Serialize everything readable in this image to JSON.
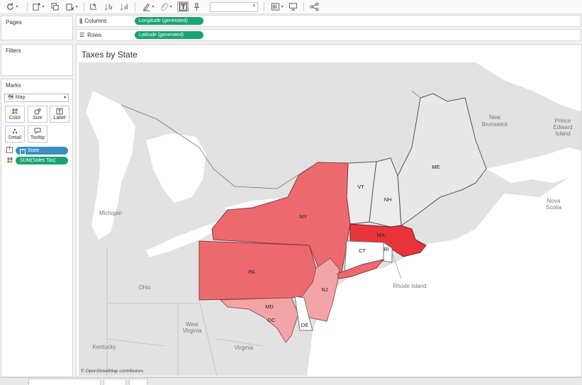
{
  "shelves": {
    "pages_title": "Pages",
    "filters_title": "Filters",
    "columns_label": "Columns",
    "columns_pill": "Longitude (generated)",
    "rows_label": "Rows",
    "rows_pill": "Latitude (generated)"
  },
  "marks": {
    "title": "Marks",
    "type_value": "Map",
    "buttons": {
      "color": "Color",
      "size": "Size",
      "label": "Label",
      "detail": "Detail",
      "tooltip": "Tooltip"
    },
    "state_pill": "State",
    "sales_tax_pill": "SUM(Sales Tax)"
  },
  "view": {
    "title": "Taxes by State",
    "attribution": "© OpenStreetMap contributors"
  },
  "map": {
    "state_labels": {
      "me": "ME",
      "vt": "VT",
      "nh": "NH",
      "ny": "NY",
      "ma": "MA",
      "ct": "CT",
      "ri": "RI",
      "pa": "PA",
      "nj": "NJ",
      "md": "MD",
      "de": "DE",
      "dc": "DC"
    },
    "place_labels": {
      "new_brunswick_1": "New",
      "new_brunswick_2": "Brunswick",
      "pei_1": "Prince",
      "pei_2": "Edward",
      "pei_3": "Island",
      "nova_scotia_1": "Nova",
      "nova_scotia_2": "Scotia",
      "michigan": "Michigan",
      "ohio": "Ohio",
      "west_virginia_1": "West",
      "west_virginia_2": "Virginia",
      "virginia": "Virginia",
      "kentucky": "Kentucky",
      "rhode_island": "Rhode Island"
    },
    "colors": {
      "ma": "#e8343a",
      "ny": "#ec6a6e",
      "pa": "#ec6a6e",
      "nj": "#f2a4a7",
      "md": "#f2a4a7",
      "ct": "#ffffff",
      "de": "#ffffff",
      "others": "#e6e6e6",
      "water": "#ffffff",
      "land": "#e0e0e0"
    }
  }
}
